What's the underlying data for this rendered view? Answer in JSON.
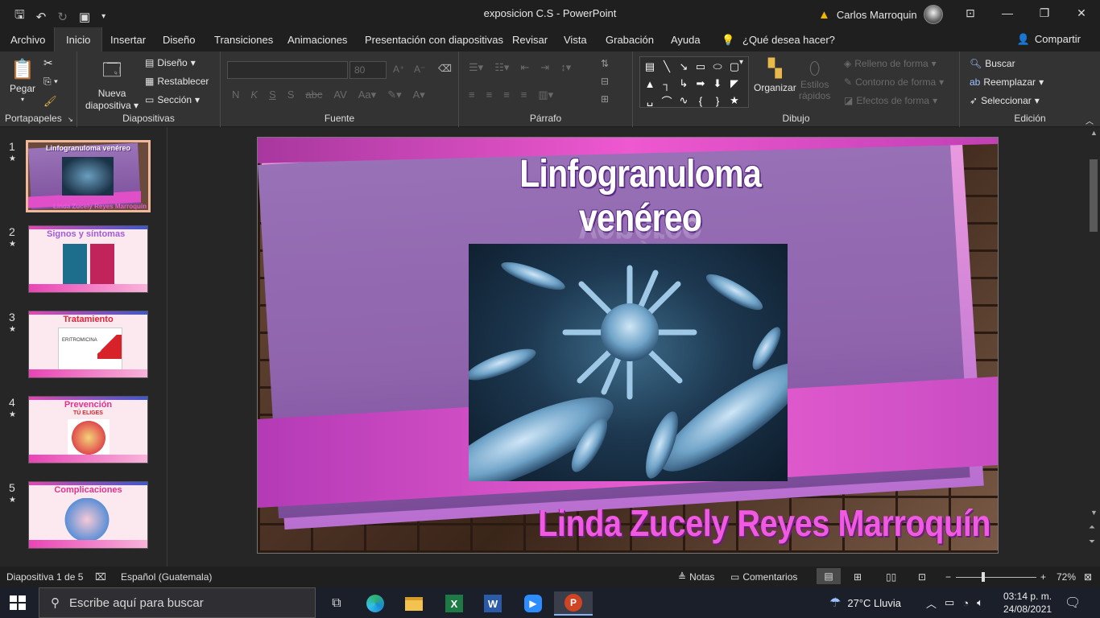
{
  "window": {
    "title": "exposicion C.S  -  PowerPoint",
    "user_name": "Carlos Marroquin"
  },
  "ribbon_tabs": [
    "Archivo",
    "Inicio",
    "Insertar",
    "Diseño",
    "Transiciones",
    "Animaciones",
    "Presentación con diapositivas",
    "Revisar",
    "Vista",
    "Grabación",
    "Ayuda"
  ],
  "tell_me": "¿Qué desea hacer?",
  "share_label": "Compartir",
  "ribbon": {
    "portapapeles": {
      "label": "Portapapeles",
      "paste": "Pegar"
    },
    "diapositivas": {
      "label": "Diapositivas",
      "new_slide_1": "Nueva",
      "new_slide_2": "diapositiva",
      "layout": "Diseño",
      "reset": "Restablecer",
      "section": "Sección"
    },
    "fuente": {
      "label": "Fuente",
      "size": "80"
    },
    "parrafo": {
      "label": "Párrafo"
    },
    "dibujo": {
      "label": "Dibujo",
      "arrange": "Organizar",
      "quick_styles_1": "Estilos",
      "quick_styles_2": "rápidos",
      "fill": "Relleno de forma",
      "outline": "Contorno de forma",
      "effects": "Efectos de forma"
    },
    "edicion": {
      "label": "Edición",
      "find": "Buscar",
      "replace": "Reemplazar",
      "select": "Seleccionar"
    }
  },
  "thumbnails": [
    {
      "num": "1",
      "title": "Linfogranuloma venéreo",
      "footer": "Linda Zucely Reyes Marroquín"
    },
    {
      "num": "2",
      "title": "Signos y síntomas"
    },
    {
      "num": "3",
      "title": "Tratamiento",
      "sub": "ERITROMICINA"
    },
    {
      "num": "4",
      "title": "Prevención",
      "sub": "TÚ ELIGES"
    },
    {
      "num": "5",
      "title": "Complicaciones"
    }
  ],
  "slide": {
    "title": "Linfogranuloma venéreo",
    "author": "Linda Zucely Reyes Marroquín"
  },
  "status": {
    "slide_info": "Diapositiva 1 de 5",
    "language": "Español (Guatemala)",
    "notes": "Notas",
    "comments": "Comentarios",
    "zoom": "72%"
  },
  "taskbar": {
    "search_placeholder": "Escribe aquí para buscar",
    "weather": "27°C  Lluvia",
    "time": "03:14 p. m.",
    "date": "24/08/2021"
  },
  "colors": {
    "accent_magenta": "#e944b5",
    "title_outline": "#5a2a86",
    "author_pink": "#f05ae0"
  }
}
